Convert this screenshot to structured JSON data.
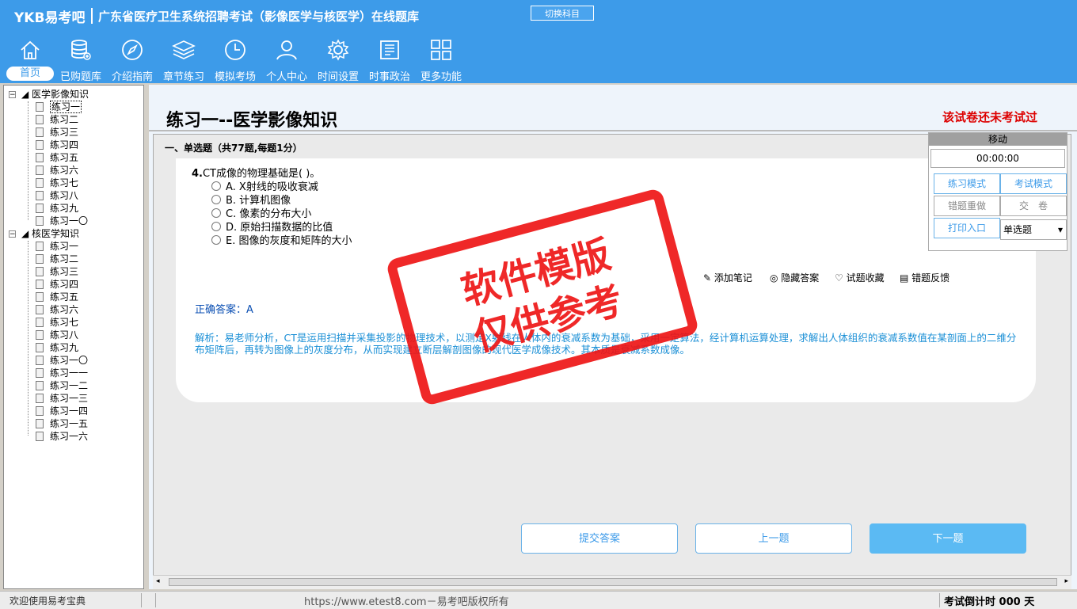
{
  "header": {
    "logo": "YKB易考吧",
    "title": "广东省医疗卫生系统招聘考试（影像医学与核医学）在线题库",
    "switch_label": "切换科目",
    "nav": [
      {
        "label": "首页",
        "icon": "home-icon"
      },
      {
        "label": "已购题库",
        "icon": "database-icon"
      },
      {
        "label": "介绍指南",
        "icon": "compass-icon"
      },
      {
        "label": "章节练习",
        "icon": "layers-icon"
      },
      {
        "label": "模拟考场",
        "icon": "clock-icon"
      },
      {
        "label": "个人中心",
        "icon": "user-icon"
      },
      {
        "label": "时间设置",
        "icon": "gear-icon"
      },
      {
        "label": "时事政治",
        "icon": "news-icon"
      },
      {
        "label": "更多功能",
        "icon": "grid-icon"
      }
    ]
  },
  "tree": {
    "groups": [
      {
        "label": "医学影像知识",
        "items": [
          "练习一",
          "练习二",
          "练习三",
          "练习四",
          "练习五",
          "练习六",
          "练习七",
          "练习八",
          "练习九",
          "练习一〇"
        ]
      },
      {
        "label": "核医学知识",
        "items": [
          "练习一",
          "练习二",
          "练习三",
          "练习四",
          "练习五",
          "练习六",
          "练习七",
          "练习八",
          "练习九",
          "练习一〇",
          "练习一一",
          "练习一二",
          "练习一三",
          "练习一四",
          "练习一五",
          "练习一六"
        ]
      }
    ],
    "selected": "练习一"
  },
  "paper": {
    "title": "练习一--医学影像知识",
    "status": "该试卷还未考试过",
    "section": "一、单选题（共77题,每题1分）",
    "question_no": "4.",
    "question": "CT成像的物理基础是( )。",
    "options": [
      "A. X射线的吸收衰减",
      "B. 计算机图像",
      "C. 像素的分布大小",
      "D. 原始扫描数据的比值",
      "E. 图像的灰度和矩阵的大小"
    ],
    "tools": [
      "添加笔记",
      "隐藏答案",
      "试题收藏",
      "错题反馈"
    ],
    "answer_label": "正确答案：",
    "answer_value": "A",
    "explanation": "解析：易老师分析，CT是运用扫描并采集投影的物理技术，以测定X射线在人体内的衰减系数为基础，采用一定算法，经计算机运算处理，求解出人体组织的衰减系数值在某剖面上的二维分布矩阵后，再转为图像上的灰度分布，从而实现建立断层解剖图像的现代医学成像技术。其本质是衰减系数成像。",
    "buttons": {
      "submit": "提交答案",
      "prev": "上一题",
      "next": "下一题"
    }
  },
  "float_panel": {
    "title": "移动",
    "timer": "00:00:00",
    "practice_mode": "练习模式",
    "exam_mode": "考试模式",
    "redo_wrong": "错题重做",
    "submit_paper": "交　卷",
    "print": "打印入口",
    "type_select": "单选题"
  },
  "stamp": {
    "line1": "软件模版",
    "line2": "仅供参考"
  },
  "status": {
    "welcome": "欢迎使用易考宝典",
    "site": "https://www.etest8.com－易考吧版权所有",
    "countdown": "考试倒计时 000 天"
  },
  "colors": {
    "header": "#3d9be9",
    "accent": "#5bbaf3",
    "warning": "#dd0000"
  }
}
